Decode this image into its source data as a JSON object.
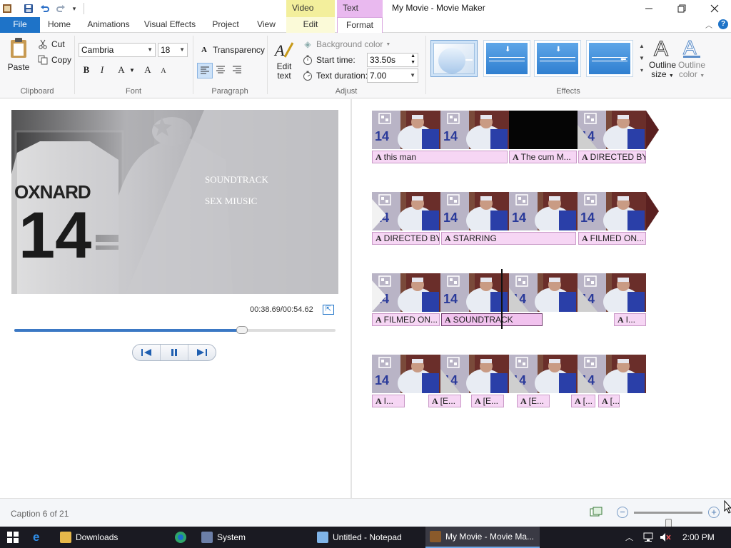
{
  "window": {
    "title": "My Movie - Movie Maker",
    "context_tabs": {
      "video_tools": "Video Tools",
      "text_tools": "Text Tools"
    }
  },
  "ribbon": {
    "tabs": [
      "File",
      "Home",
      "Animations",
      "Visual Effects",
      "Project",
      "View",
      "Edit",
      "Format"
    ],
    "active_tab": "Format",
    "clipboard": {
      "paste": "Paste",
      "cut": "Cut",
      "copy": "Copy",
      "label": "Clipboard"
    },
    "font": {
      "family": "Cambria",
      "size": "18",
      "bold": "B",
      "italic": "I",
      "color": "A",
      "grow": "A",
      "shrink": "A",
      "label": "Font"
    },
    "paragraph": {
      "transparency": "Transparency",
      "label": "Paragraph"
    },
    "adjust": {
      "edit_text_line1": "Edit",
      "edit_text_line2": "text",
      "background_color": "Background color",
      "start_time_label": "Start time:",
      "start_time_value": "33.50s",
      "text_duration_label": "Text duration:",
      "text_duration_value": "7.00",
      "label": "Adjust"
    },
    "effects": {
      "label": "Effects",
      "outline_size_line1": "Outline",
      "outline_size_line2": "size",
      "outline_color_line1": "Outline",
      "outline_color_line2": "color"
    }
  },
  "preview": {
    "overlay_line1": "SOUNDTRACK",
    "overlay_line2": "SEX MIUSIC",
    "jersey_name": "OXNARD",
    "jersey_number": "14",
    "timecode": "00:38.69/00:54.62",
    "progress_fraction": 0.708
  },
  "storyboard": {
    "row1": [
      "this man",
      "The cum M...",
      "DIRECTED BY"
    ],
    "row2": [
      "DIRECTED BY",
      "STARRING",
      "FILMED ON..."
    ],
    "row3": [
      "FILMED ON...",
      "SOUNDTRACK",
      "I..."
    ],
    "row4": [
      "I...",
      "[E...",
      "[E...",
      "[E...",
      "[...",
      "[..."
    ]
  },
  "status": {
    "text": "Caption 6 of 21",
    "zoom_fraction": 0.5
  },
  "taskbar": {
    "items": [
      "Downloads",
      "System",
      "Untitled - Notepad",
      "My Movie - Movie Ma..."
    ],
    "time": "2:00 PM"
  },
  "colors": {
    "accent": "#1e73c8",
    "caption_pink": "#f6d6f4",
    "video_tools": "#f3ef9c",
    "text_tools": "#e9b9ef"
  }
}
